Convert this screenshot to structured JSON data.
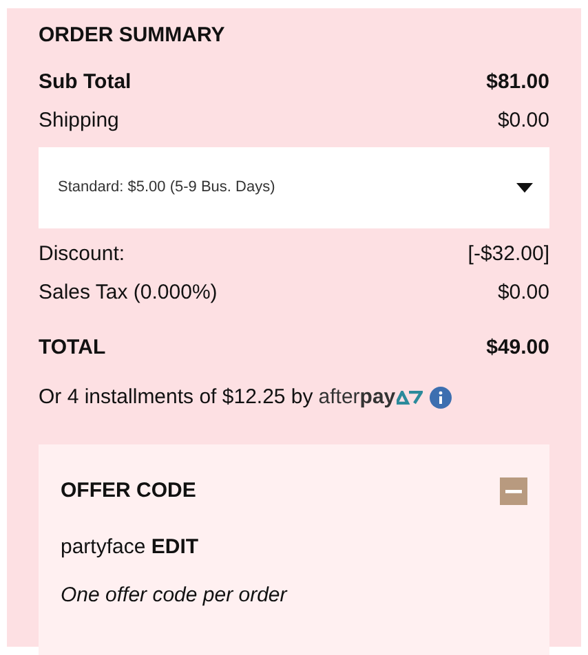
{
  "title": "ORDER SUMMARY",
  "rows_top": [
    {
      "label": "Sub Total",
      "value": "$81.00",
      "kind": "strong"
    },
    {
      "label": "Shipping",
      "value": "$0.00",
      "kind": "plain"
    }
  ],
  "shipping_select": {
    "value": "Standard: $5.00 (5-9 Bus. Days)"
  },
  "rows_bottom": [
    {
      "label": "Discount:",
      "value": "[-$32.00]",
      "kind": "plain"
    },
    {
      "label": "Sales Tax (0.000%)",
      "value": "$0.00",
      "kind": "plain"
    },
    {
      "label": "TOTAL",
      "value": "$49.00",
      "kind": "strong"
    }
  ],
  "installments": {
    "text": "Or 4 installments of $12.25 by",
    "logo": "after**pay**"
  },
  "offer_code": {
    "title": "OFFER CODE",
    "expanded": true,
    "code": "partyface",
    "edit_link": "EDIT",
    "note": "One offer code per order"
  }
}
